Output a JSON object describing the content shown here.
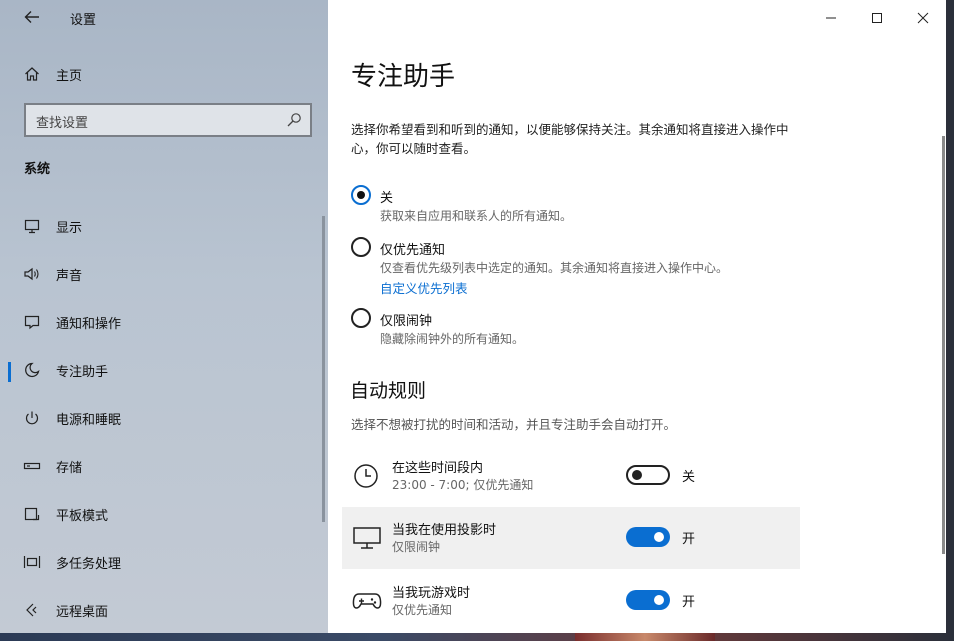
{
  "window": {
    "app_title": "设置"
  },
  "sidebar": {
    "home_label": "主页",
    "search_placeholder": "查找设置",
    "section_header": "系统",
    "items": [
      {
        "label": "显示",
        "icon": "monitor-icon"
      },
      {
        "label": "声音",
        "icon": "speaker-icon"
      },
      {
        "label": "通知和操作",
        "icon": "notification-icon"
      },
      {
        "label": "专注助手",
        "icon": "moon-icon",
        "active": true
      },
      {
        "label": "电源和睡眠",
        "icon": "power-icon"
      },
      {
        "label": "存储",
        "icon": "storage-icon"
      },
      {
        "label": "平板模式",
        "icon": "tablet-icon"
      },
      {
        "label": "多任务处理",
        "icon": "multitask-icon"
      },
      {
        "label": "远程桌面",
        "icon": "remote-desktop-icon"
      }
    ]
  },
  "main": {
    "title": "专注助手",
    "description": "选择你希望看到和听到的通知，以便能够保持关注。其余通知将直接进入操作中心，你可以随时查看。",
    "options": [
      {
        "label": "关",
        "sub": "获取来自应用和联系人的所有通知。",
        "selected": true
      },
      {
        "label": "仅优先通知",
        "sub": "仅查看优先级列表中选定的通知。其余通知将直接进入操作中心。",
        "link": "自定义优先列表",
        "selected": false
      },
      {
        "label": "仅限闹钟",
        "sub": "隐藏除闹钟外的所有通知。",
        "selected": false
      }
    ],
    "auto_rules": {
      "title": "自动规则",
      "description": "选择不想被打扰的时间和活动，并且专注助手会自动打开。",
      "rules": [
        {
          "title": "在这些时间段内",
          "sub": "23:00 - 7:00; 仅优先通知",
          "state": "关",
          "on": false,
          "icon": "clock-icon"
        },
        {
          "title": "当我在使用投影时",
          "sub": "仅限闹钟",
          "state": "开",
          "on": true,
          "icon": "projector-icon"
        },
        {
          "title": "当我玩游戏时",
          "sub": "仅优先通知",
          "state": "开",
          "on": true,
          "icon": "gamepad-icon"
        }
      ]
    }
  },
  "colors": {
    "accent": "#0a6ed1"
  }
}
